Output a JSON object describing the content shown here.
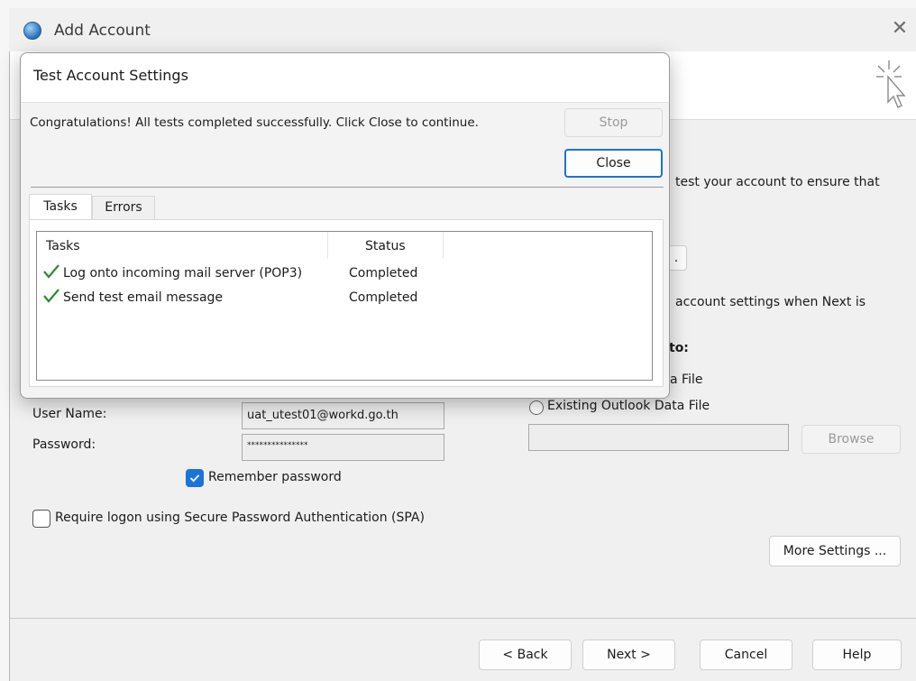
{
  "window": {
    "title": "Add Account",
    "close_icon": "close-icon"
  },
  "background": {
    "partial_text_1": "test your account to ensure that",
    "partial_button": ".",
    "partial_text_2": "account settings when Next is",
    "partial_heading": "to:",
    "partial_option": "a File",
    "existing_data_file_label": "Existing Outlook Data File",
    "existing_data_file_value": "",
    "browse_label": "Browse",
    "user_name_label": "User Name:",
    "user_name_value": "uat_utest01@workd.go.th",
    "password_label": "Password:",
    "password_value": "***************",
    "remember_password_label": "Remember password",
    "remember_password_checked": true,
    "spa_label": "Require logon using Secure Password Authentication (SPA)",
    "spa_checked": false,
    "more_settings_label": "More Settings ...",
    "back_label": "< Back",
    "next_label": "Next >",
    "cancel_label": "Cancel",
    "help_label": "Help"
  },
  "dialog": {
    "title": "Test Account Settings",
    "message": "Congratulations! All tests completed successfully. Click Close to continue.",
    "stop_label": "Stop",
    "close_label": "Close",
    "tabs": [
      {
        "label": "Tasks",
        "active": true
      },
      {
        "label": "Errors",
        "active": false
      }
    ],
    "columns": {
      "tasks": "Tasks",
      "status": "Status"
    },
    "rows": [
      {
        "task": "Log onto incoming mail server (POP3)",
        "status": "Completed"
      },
      {
        "task": "Send test email message",
        "status": "Completed"
      }
    ]
  },
  "colors": {
    "accent": "#1a73d9",
    "check_green": "#2e8b2e"
  }
}
